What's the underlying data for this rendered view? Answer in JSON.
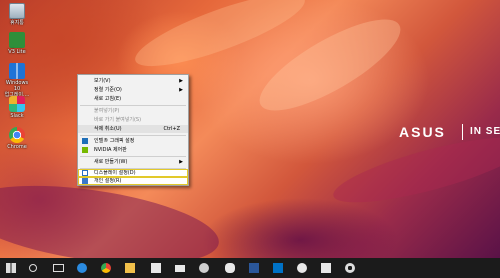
{
  "desktop": {
    "icons": [
      {
        "name": "recycle-bin-icon",
        "label": "휴지통"
      },
      {
        "name": "v3-lite-icon",
        "label": "V3 Lite"
      },
      {
        "name": "windows10-upgrade-icon",
        "label": "Windows 10\n업그레이...."
      },
      {
        "name": "slack-icon",
        "label": "Slack"
      },
      {
        "name": "chrome-icon",
        "label": "Chrome"
      }
    ],
    "brand": "ASUS",
    "tagline": "IN SE"
  },
  "context_menu": {
    "view": "보기(V)",
    "sort_by": "정렬 기준(O)",
    "refresh": "새로 고침(E)",
    "paste": "붙여넣기(P)",
    "paste_shortcut": "바로 가기 붙여넣기(S)",
    "undo_delete": "삭제 취소(U)",
    "undo_shortcut": "Ctrl+Z",
    "intel_graphics": "인텔® 그래픽 설정",
    "nvidia_panel": "NVIDIA 제어판",
    "new": "새로 만들기(W)",
    "display_settings": "디스플레이 설정(D)",
    "personalize": "개인 설정(R)"
  },
  "taskbar": {
    "items": [
      "start-icon",
      "search-icon",
      "task-view-icon",
      "edge-icon",
      "chrome-icon",
      "file-explorer-icon",
      "store-icon",
      "mail-icon",
      "weather-icon",
      "kakaotalk-icon",
      "word-icon",
      "outlook-icon",
      "skype-icon",
      "photos-icon",
      "settings-icon"
    ]
  }
}
